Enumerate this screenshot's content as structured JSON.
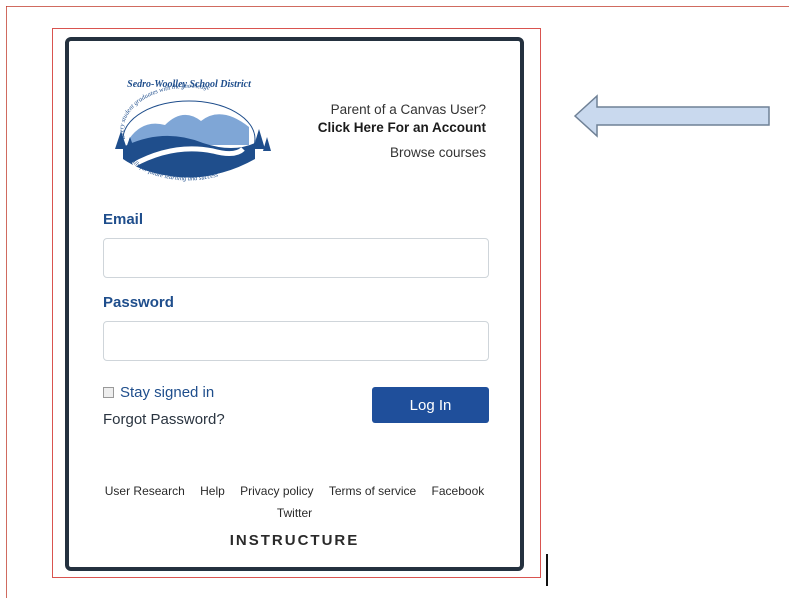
{
  "logo": {
    "district_name": "Sedro-Woolley School District",
    "motto_top": "Every student graduates with the knowledge",
    "motto_bottom": "and skills for future learning and success"
  },
  "top_links": {
    "parent_question": "Parent of a Canvas User?",
    "click_here": "Click Here For an Account",
    "browse_courses": "Browse courses"
  },
  "form": {
    "email_label": "Email",
    "email_value": "",
    "password_label": "Password",
    "password_value": "",
    "stay_signed_in": "Stay signed in",
    "forgot_password": "Forgot Password?",
    "login_button": "Log In"
  },
  "footer": {
    "links": [
      "User Research",
      "Help",
      "Privacy policy",
      "Terms of service",
      "Facebook"
    ],
    "twitter": "Twitter",
    "brand": "INSTRUCTURE"
  },
  "colors": {
    "label_blue": "#1f4e8c",
    "button_blue": "#1f4f9b",
    "card_border": "#24313f",
    "arrow_fill": "#c9d9ee",
    "arrow_stroke": "#6f8196"
  }
}
